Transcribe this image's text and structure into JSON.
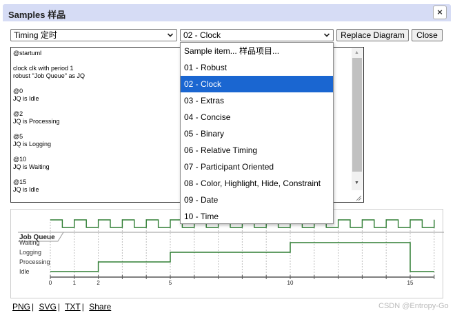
{
  "dialog": {
    "title": "Samples 样品",
    "close_glyph": "×"
  },
  "toolbar": {
    "category_select_value": "Timing 定时",
    "sample_select_value": "02 - Clock",
    "replace_button": "Replace Diagram",
    "close_button": "Close"
  },
  "editor": {
    "code": "@startuml\n\nclock clk with period 1\nrobust \"Job Queue\" as JQ\n\n@0\nJQ is Idle\n\n@2\nJQ is Processing\n\n@5\nJQ is Logging\n\n@10\nJQ is Waiting\n\n@15\nJQ is Idle"
  },
  "dropdown": {
    "items": [
      "Sample item... 样品项目...",
      "01 - Robust",
      "02 - Clock",
      "03 - Extras",
      "04 - Concise",
      "05 - Binary",
      "06 - Relative Timing",
      "07 - Participant Oriented",
      "08 - Color, Highlight, Hide, Constraint",
      "09 - Date",
      "10 - Time"
    ],
    "selected_index": 2,
    "selected_color": "#1a66d1"
  },
  "diagram": {
    "robust_title": "Job Queue",
    "states": [
      "Waiting",
      "Logging",
      "Processing",
      "Idle"
    ],
    "ticks": [
      "0",
      "1",
      "2",
      "5",
      "10",
      "15"
    ],
    "transitions": [
      {
        "t": 0,
        "state": "Idle"
      },
      {
        "t": 2,
        "state": "Processing"
      },
      {
        "t": 5,
        "state": "Logging"
      },
      {
        "t": 10,
        "state": "Waiting"
      },
      {
        "t": 15,
        "state": "Idle"
      }
    ],
    "clock_period": 1,
    "signal_color": "#2e7d32"
  },
  "links": {
    "png": "PNG",
    "svg": "SVG",
    "txt": "TXT",
    "share": "Share",
    "separator": "|"
  },
  "watermark": "CSDN @Entropy-Go"
}
